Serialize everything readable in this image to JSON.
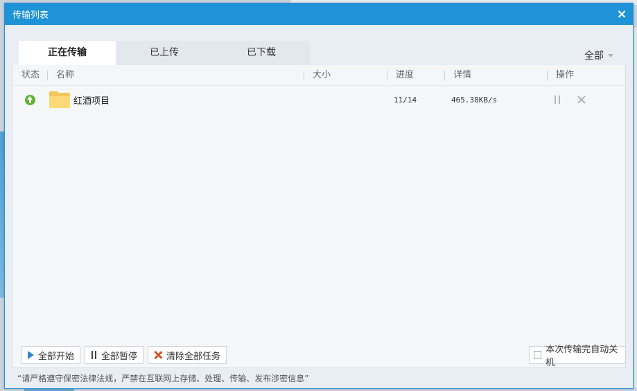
{
  "window": {
    "title": "传输列表"
  },
  "tabs": [
    {
      "label": "正在传输",
      "active": true
    },
    {
      "label": "已上传",
      "active": false
    },
    {
      "label": "已下载",
      "active": false
    }
  ],
  "filter": {
    "label": "全部"
  },
  "columns": [
    "状态",
    "名称",
    "大小",
    "进度",
    "详情",
    "操作"
  ],
  "rows": [
    {
      "status_icon": "upload-icon",
      "name": "红酒项目",
      "size": "",
      "progress": "11/14",
      "detail": "465.38KB/s"
    }
  ],
  "bottom": {
    "start_all": "全部开始",
    "pause_all": "全部暂停",
    "clear_all": "清除全部任务",
    "shutdown_label": "本次传输完自动关机"
  },
  "notice": "“请严格遵守保密法律法规，严禁在互联网上存储、处理、传输、发布涉密信息”",
  "colors": {
    "titlebar": "#1e93d7",
    "upload_status": "#5cb531",
    "play": "#2f86d2",
    "clear": "#d4502f"
  }
}
